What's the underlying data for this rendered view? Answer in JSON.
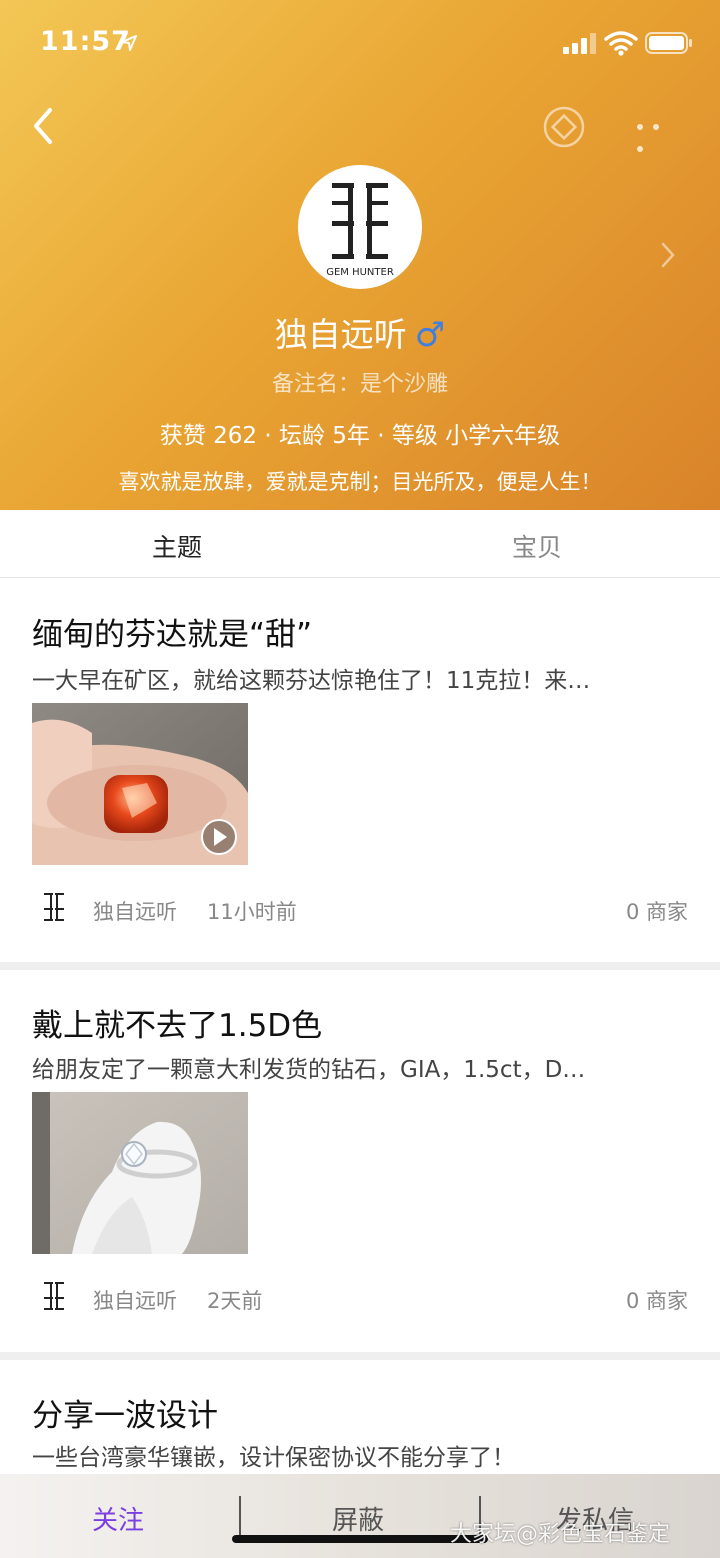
{
  "status_bar": {
    "time": "11:57"
  },
  "profile": {
    "avatar_caption": "GEM HUNTER",
    "username": "独自远听",
    "gender_symbol": "♂",
    "remark": "备注名：是个沙雕",
    "stats": "获赞 262 · 坛龄 5年 · 等级 小学六年级",
    "motto": "喜欢就是放肆，爱就是克制；目光所及，便是人生！"
  },
  "tabs": [
    {
      "label": "主题",
      "active": true
    },
    {
      "label": "宝贝",
      "active": false
    }
  ],
  "posts": [
    {
      "title": "缅甸的芬达就是“甜”",
      "excerpt": "一大早在矿区，就给这颗芬达惊艳住了！11克拉！来…",
      "author": "独自远听",
      "time": "11小时前",
      "shop": "0  商家",
      "thumb_icon": "gem-in-hand-image",
      "has_video": true
    },
    {
      "title": "戴上就不去了1.5D色",
      "excerpt": "给朋友定了一颗意大利发货的钻石，GIA，1.5ct，D…",
      "author": "独自远听",
      "time": "2天前",
      "shop": "0  商家",
      "thumb_icon": "diamond-ring-image",
      "has_video": false
    },
    {
      "title": "分享一波设计",
      "excerpt": "一些台湾豪华镶嵌，设计保密协议不能分享了！"
    }
  ],
  "bottom_bar": {
    "follow": "关注",
    "block": "屏蔽",
    "message": "发私信"
  },
  "watermark": "大家坛@彩色宝石鉴定",
  "colors": {
    "accent_purple": "#7b3fe0",
    "header_gradient_start": "#f3c755",
    "header_gradient_end": "#d9832a",
    "gender_blue": "#3f7fe0"
  }
}
